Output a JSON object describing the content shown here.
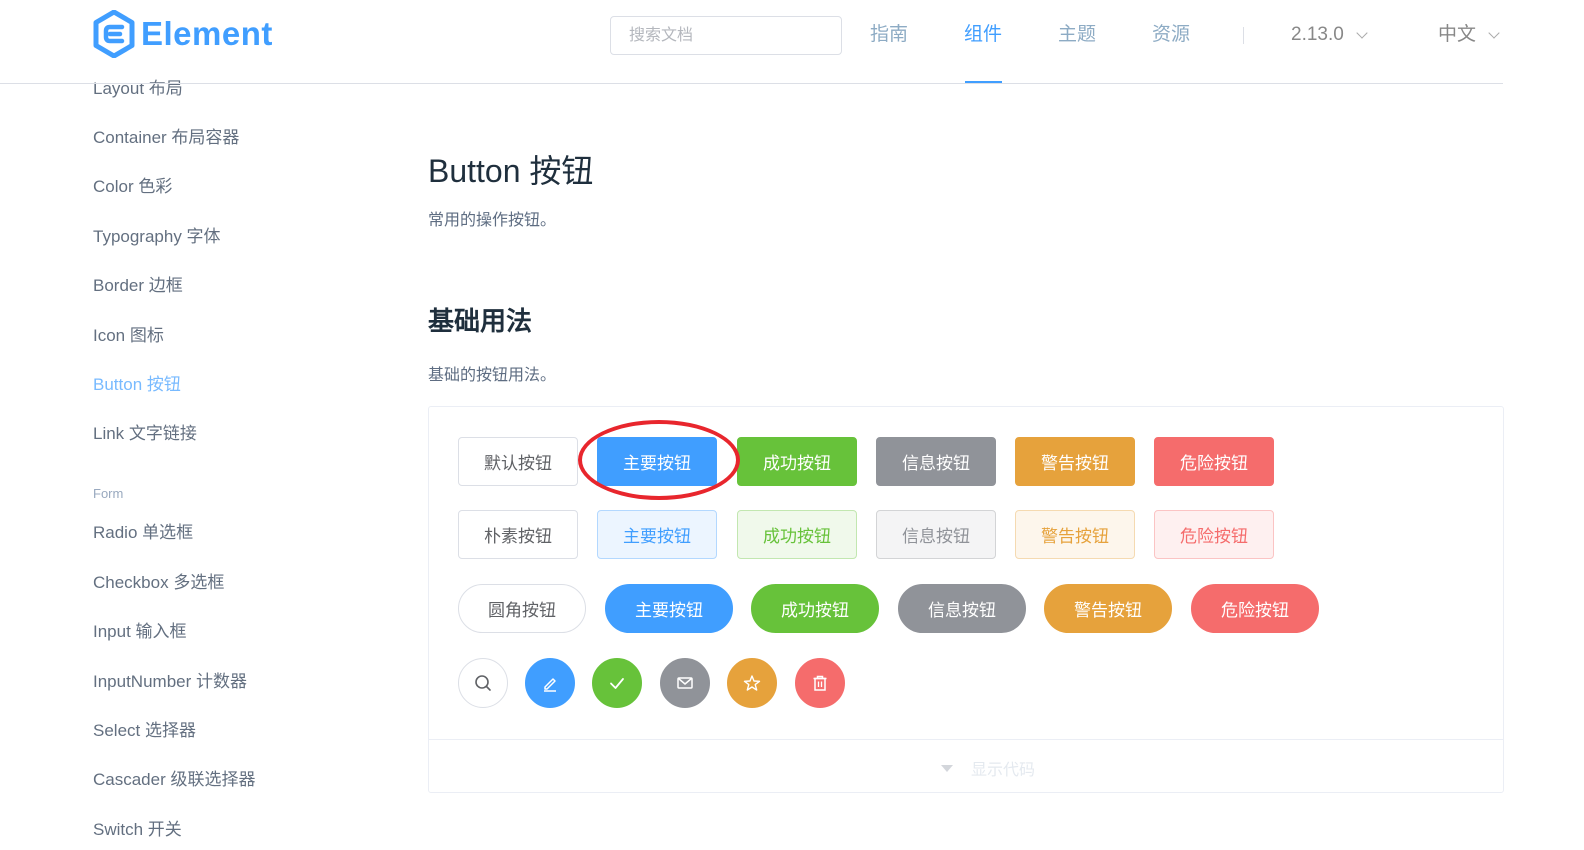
{
  "header": {
    "logo_text": "Element",
    "search_placeholder": "搜索文档",
    "nav": [
      "指南",
      "组件",
      "主题",
      "资源"
    ],
    "active_nav": "组件",
    "version": "2.13.0",
    "language": "中文"
  },
  "sidebar": {
    "items": [
      {
        "label": "Layout 布局"
      },
      {
        "label": "Container 布局容器"
      },
      {
        "label": "Color 色彩"
      },
      {
        "label": "Typography 字体"
      },
      {
        "label": "Border 边框"
      },
      {
        "label": "Icon 图标"
      },
      {
        "label": "Button 按钮",
        "active": true
      },
      {
        "label": "Link 文字链接"
      }
    ],
    "group_form": "Form",
    "form_items": [
      {
        "label": "Radio 单选框"
      },
      {
        "label": "Checkbox 多选框"
      },
      {
        "label": "Input 输入框"
      },
      {
        "label": "InputNumber 计数器"
      },
      {
        "label": "Select 选择器"
      },
      {
        "label": "Cascader 级联选择器"
      },
      {
        "label": "Switch 开关"
      }
    ]
  },
  "main": {
    "title": "Button 按钮",
    "description": "常用的操作按钮。",
    "section_title": "基础用法",
    "section_description": "基础的按钮用法。",
    "rows": {
      "default": [
        "默认按钮",
        "主要按钮",
        "成功按钮",
        "信息按钮",
        "警告按钮",
        "危险按钮"
      ],
      "plain": [
        "朴素按钮",
        "主要按钮",
        "成功按钮",
        "信息按钮",
        "警告按钮",
        "危险按钮"
      ],
      "round": [
        "圆角按钮",
        "主要按钮",
        "成功按钮",
        "信息按钮",
        "警告按钮",
        "危险按钮"
      ]
    },
    "circle_icons": [
      "search-icon",
      "edit-icon",
      "check-icon",
      "message-icon",
      "star-icon",
      "delete-icon"
    ],
    "show_code": "显示代码"
  },
  "colors": {
    "primary": "#409eff",
    "success": "#67c23a",
    "info": "#909399",
    "warning": "#e6a23c",
    "danger": "#f56c6c",
    "annotation": "#e8262d"
  }
}
